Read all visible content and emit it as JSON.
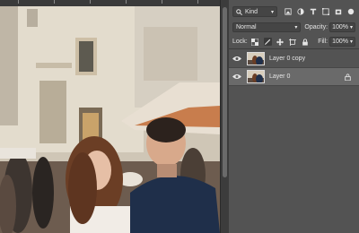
{
  "canvas": {
    "image": "photo-couple-street"
  },
  "layers_panel": {
    "filter_kind": {
      "label": "Kind",
      "icons": [
        "image-filter-icon",
        "adjustment-filter-icon",
        "type-filter-icon",
        "shape-filter-icon",
        "smart-object-filter-icon",
        "filter-toggle-icon"
      ]
    },
    "blend_mode": "Normal",
    "opacity_label": "Opacity:",
    "opacity_value": "100%",
    "lock_label": "Lock:",
    "lock_icons": [
      "lock-transparent-icon",
      "lock-image-icon",
      "lock-position-icon",
      "lock-artboard-icon",
      "lock-all-icon"
    ],
    "fill_label": "Fill:",
    "fill_value": "100%",
    "layers": [
      {
        "name": "Layer 0 copy",
        "visible": true,
        "locked": false,
        "selected": false
      },
      {
        "name": "Layer 0",
        "visible": true,
        "locked": true,
        "selected": true
      }
    ]
  },
  "colors": {
    "panel_bg": "#535353",
    "selected_layer": "#6a6a6a",
    "text": "#e6e6e6"
  }
}
